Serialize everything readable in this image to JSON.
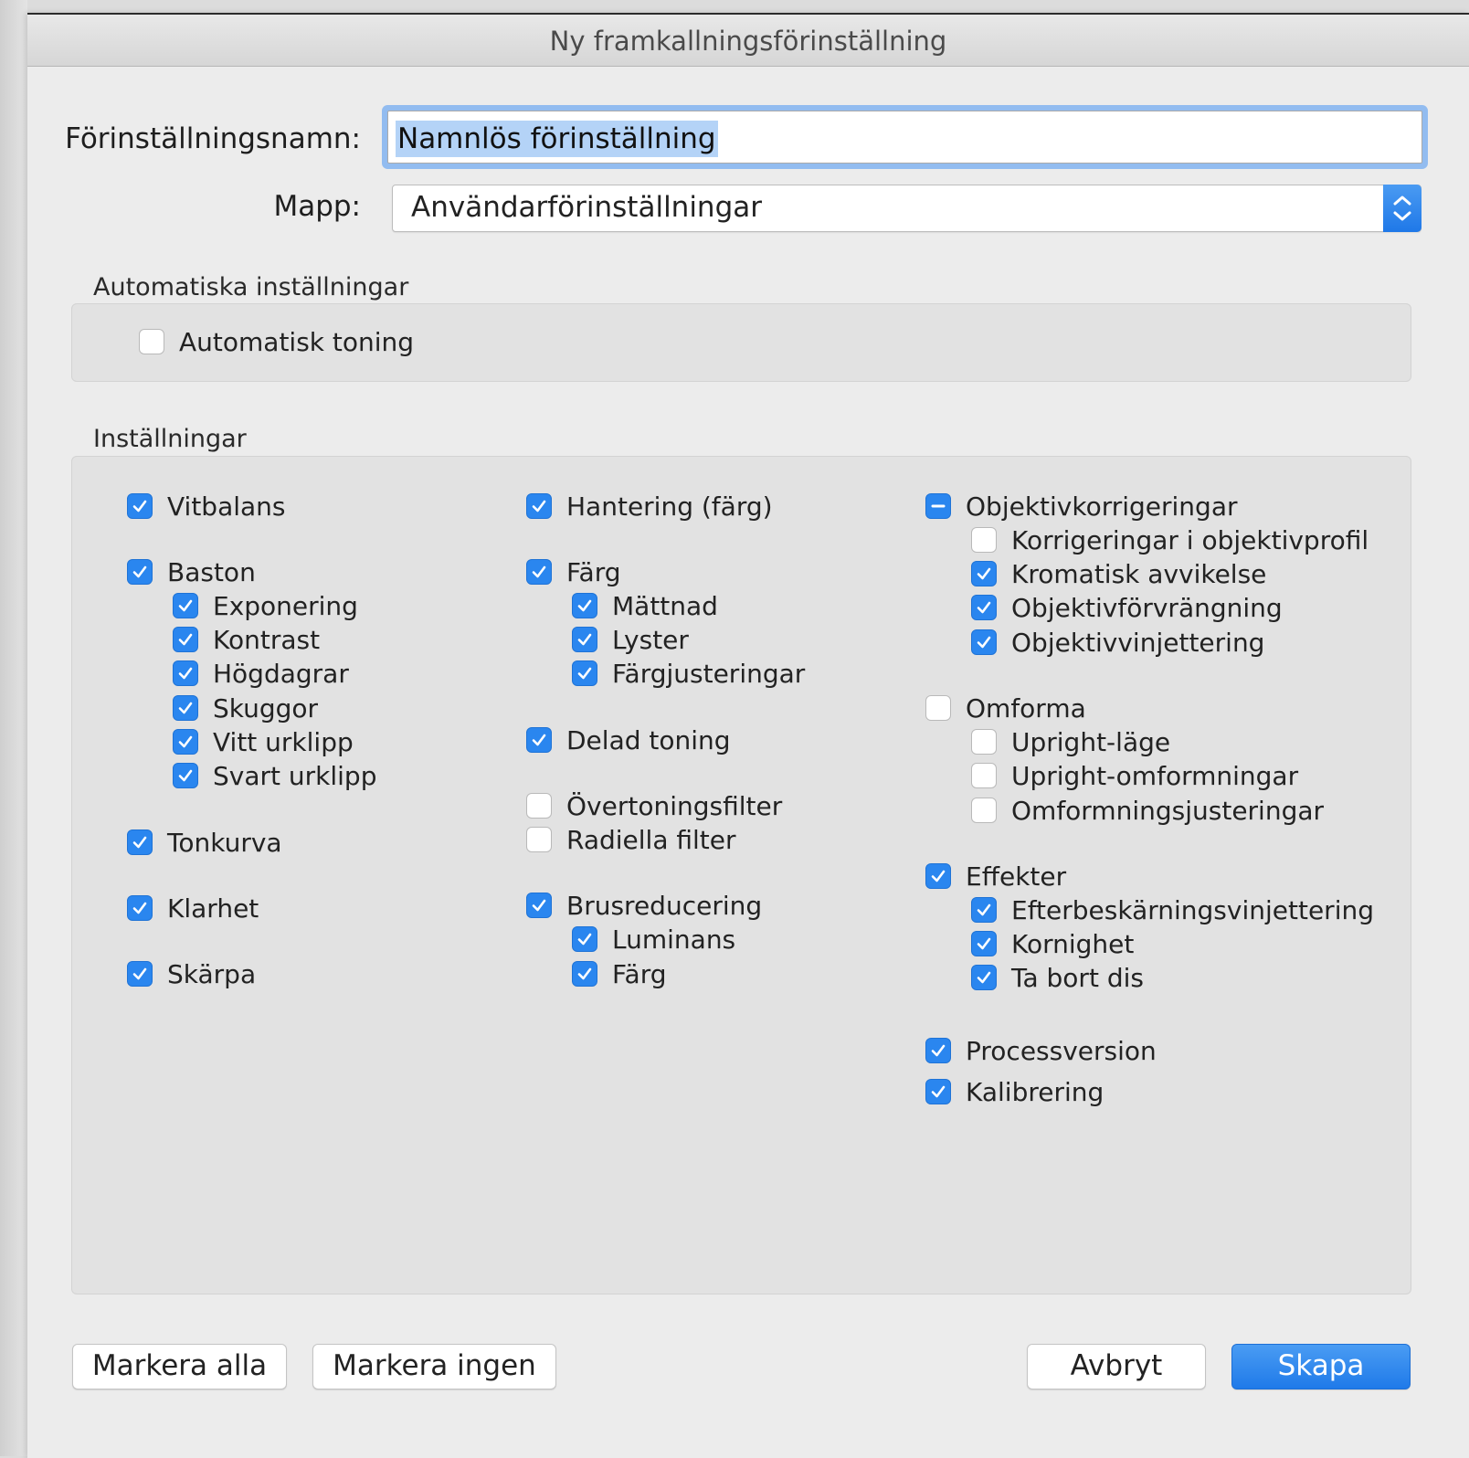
{
  "dialog": {
    "title": "Ny framkallningsförinställning"
  },
  "form": {
    "name_label": "Förinställningsnamn:",
    "name_value": "Namnlös förinställning",
    "folder_label": "Mapp:",
    "folder_value": "Användarförinställningar"
  },
  "auto": {
    "title": "Automatiska inställningar",
    "auto_tone": {
      "label": "Automatisk toning",
      "state": "off"
    }
  },
  "settings": {
    "title": "Inställningar",
    "col1": [
      {
        "label": "Vitbalans",
        "state": "on"
      },
      {
        "label": "Baston",
        "state": "on"
      },
      {
        "label": "Exponering",
        "state": "on"
      },
      {
        "label": "Kontrast",
        "state": "on"
      },
      {
        "label": "Högdagrar",
        "state": "on"
      },
      {
        "label": "Skuggor",
        "state": "on"
      },
      {
        "label": "Vitt urklipp",
        "state": "on"
      },
      {
        "label": "Svart urklipp",
        "state": "on"
      },
      {
        "label": "Tonkurva",
        "state": "on"
      },
      {
        "label": "Klarhet",
        "state": "on"
      },
      {
        "label": "Skärpa",
        "state": "on"
      }
    ],
    "col2": [
      {
        "label": "Hantering (färg)",
        "state": "on"
      },
      {
        "label": "Färg",
        "state": "on"
      },
      {
        "label": "Mättnad",
        "state": "on"
      },
      {
        "label": "Lyster",
        "state": "on"
      },
      {
        "label": "Färgjusteringar",
        "state": "on"
      },
      {
        "label": "Delad toning",
        "state": "on"
      },
      {
        "label": "Övertoningsfilter",
        "state": "off"
      },
      {
        "label": "Radiella filter",
        "state": "off"
      },
      {
        "label": "Brusreducering",
        "state": "on"
      },
      {
        "label": "Luminans",
        "state": "on"
      },
      {
        "label": "Färg",
        "state": "on"
      }
    ],
    "col3": [
      {
        "label": "Objektivkorrigeringar",
        "state": "mixed"
      },
      {
        "label": "Korrigeringar i objektivprofil",
        "state": "off"
      },
      {
        "label": "Kromatisk avvikelse",
        "state": "on"
      },
      {
        "label": "Objektivförvrängning",
        "state": "on"
      },
      {
        "label": "Objektivvinjettering",
        "state": "on"
      },
      {
        "label": "Omforma",
        "state": "off"
      },
      {
        "label": "Upright-läge",
        "state": "off"
      },
      {
        "label": "Upright-omformningar",
        "state": "off"
      },
      {
        "label": "Omformningsjusteringar",
        "state": "off"
      },
      {
        "label": "Effekter",
        "state": "on"
      },
      {
        "label": "Efterbeskärningsvinjettering",
        "state": "on"
      },
      {
        "label": "Kornighet",
        "state": "on"
      },
      {
        "label": "Ta bort dis",
        "state": "on"
      },
      {
        "label": "Processversion",
        "state": "on"
      },
      {
        "label": "Kalibrering",
        "state": "on"
      }
    ]
  },
  "buttons": {
    "select_all": "Markera alla",
    "select_none": "Markera ingen",
    "cancel": "Avbryt",
    "create": "Skapa"
  },
  "icons": {
    "check": "checkmark-icon",
    "mixed": "minus-icon",
    "stepper": "chevron-up-down-icon"
  },
  "colors": {
    "accent": "#2a86ef",
    "focus_ring": "#92bcf0",
    "selection": "#b4d3f7"
  }
}
